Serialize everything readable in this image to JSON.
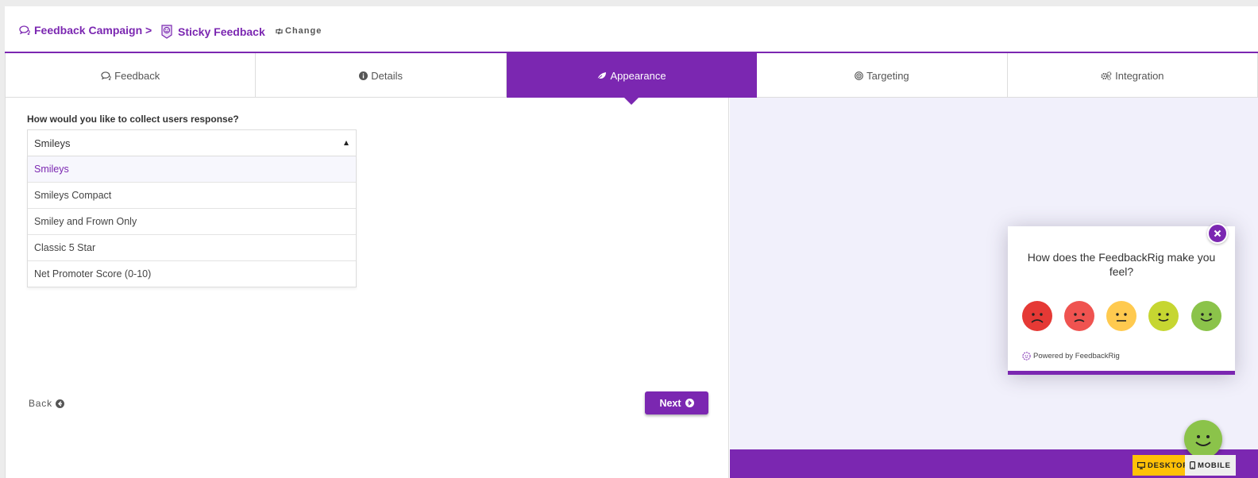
{
  "breadcrumb": {
    "campaign_label": "Feedback Campaign >",
    "current_label": "Sticky Feedback",
    "change_label": "Change"
  },
  "tabs": [
    {
      "label": "Feedback",
      "icon": "comments-icon",
      "active": false
    },
    {
      "label": "Details",
      "icon": "info-circle-icon",
      "active": false
    },
    {
      "label": "Appearance",
      "icon": "leaf-icon",
      "active": true
    },
    {
      "label": "Targeting",
      "icon": "target-icon",
      "active": false
    },
    {
      "label": "Integration",
      "icon": "gears-icon",
      "active": false
    }
  ],
  "form": {
    "question_label": "How would you like to collect users response?",
    "selected_value": "Smileys",
    "options": [
      "Smileys",
      "Smileys Compact",
      "Smiley and Frown Only",
      "Classic 5 Star",
      "Net Promoter Score (0-10)"
    ],
    "back_label": "Back",
    "next_label": "Next"
  },
  "preview": {
    "question": "How does the FeedbackRig make you feel?",
    "faces": [
      {
        "name": "very-sad",
        "color": "#e53935"
      },
      {
        "name": "sad",
        "color": "#ef5350"
      },
      {
        "name": "neutral",
        "color": "#ffca4f"
      },
      {
        "name": "happy",
        "color": "#c6d631"
      },
      {
        "name": "very-happy",
        "color": "#8bc34a"
      }
    ],
    "powered_by": "Powered by FeedbackRig",
    "device_desktop": "DESKTOP",
    "device_mobile": "MOBILE"
  },
  "colors": {
    "brand": "#7b27b1",
    "preview_bg": "#f1f0fb",
    "desktop_toggle": "#ffc107"
  }
}
